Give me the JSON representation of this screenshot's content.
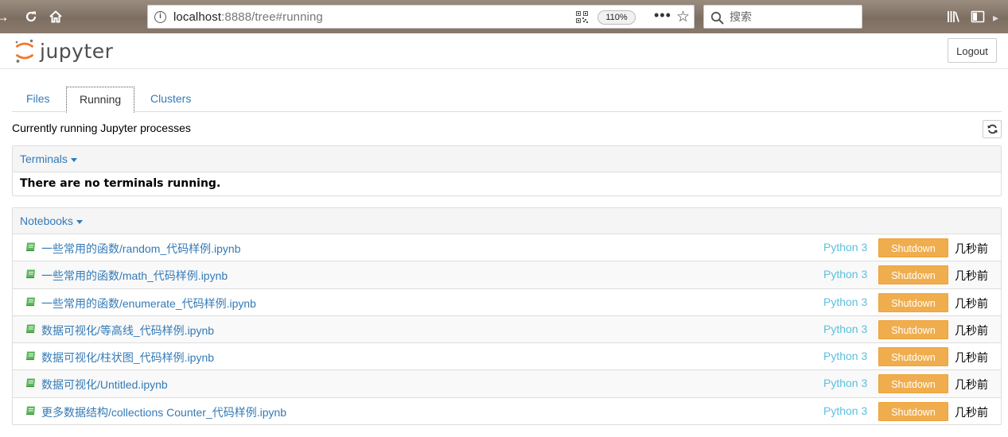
{
  "browser": {
    "url_host": "localhost",
    "url_rest": ":8888/tree#running",
    "zoom": "110%",
    "search_placeholder": "搜索"
  },
  "header": {
    "logo_text": "jupyter",
    "logout_label": "Logout"
  },
  "tabs": [
    {
      "label": "Files",
      "active": false
    },
    {
      "label": "Running",
      "active": true
    },
    {
      "label": "Clusters",
      "active": false
    }
  ],
  "running": {
    "title": "Currently running Jupyter processes",
    "terminals": {
      "heading": "Terminals",
      "empty_message": "There are no terminals running."
    },
    "notebooks": {
      "heading": "Notebooks",
      "items": [
        {
          "name": "一些常用的函数/random_代码样例.ipynb",
          "kernel": "Python 3",
          "action": "Shutdown",
          "time": "几秒前"
        },
        {
          "name": "一些常用的函数/math_代码样例.ipynb",
          "kernel": "Python 3",
          "action": "Shutdown",
          "time": "几秒前"
        },
        {
          "name": "一些常用的函数/enumerate_代码样例.ipynb",
          "kernel": "Python 3",
          "action": "Shutdown",
          "time": "几秒前"
        },
        {
          "name": "数据可视化/等高线_代码样例.ipynb",
          "kernel": "Python 3",
          "action": "Shutdown",
          "time": "几秒前"
        },
        {
          "name": "数据可视化/柱状图_代码样例.ipynb",
          "kernel": "Python 3",
          "action": "Shutdown",
          "time": "几秒前"
        },
        {
          "name": "数据可视化/Untitled.ipynb",
          "kernel": "Python 3",
          "action": "Shutdown",
          "time": "几秒前"
        },
        {
          "name": "更多数据结构/collections Counter_代码样例.ipynb",
          "kernel": "Python 3",
          "action": "Shutdown",
          "time": "几秒前"
        }
      ]
    }
  },
  "colors": {
    "link": "#337ab7",
    "kernel": "#5bc0de",
    "warning_button": "#f0ad4e",
    "notebook_icon": "#5cb85c"
  }
}
